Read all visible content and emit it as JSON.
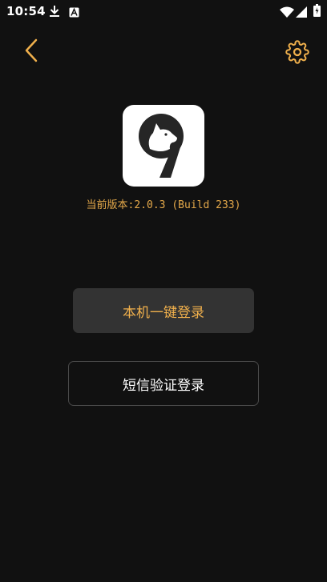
{
  "status_bar": {
    "time": "10:54",
    "left_icons": [
      "download-icon",
      "keyboard-a-icon"
    ],
    "right_icons": [
      "wifi-icon",
      "cellular-signal-icon",
      "battery-icon"
    ]
  },
  "toolbar": {
    "back_icon": "chevron-left-icon",
    "settings_icon": "gear-icon"
  },
  "app": {
    "logo": "app-logo-nine-dog",
    "version_text": "当前版本:2.0.3 (Build 233)"
  },
  "login": {
    "one_click_label": "本机一键登录",
    "sms_label": "短信验证登录"
  },
  "colors": {
    "background": "#111111",
    "accent": "#F0B04C",
    "primary_button_bg": "#333333",
    "secondary_button_border": "#4A4A4A"
  }
}
